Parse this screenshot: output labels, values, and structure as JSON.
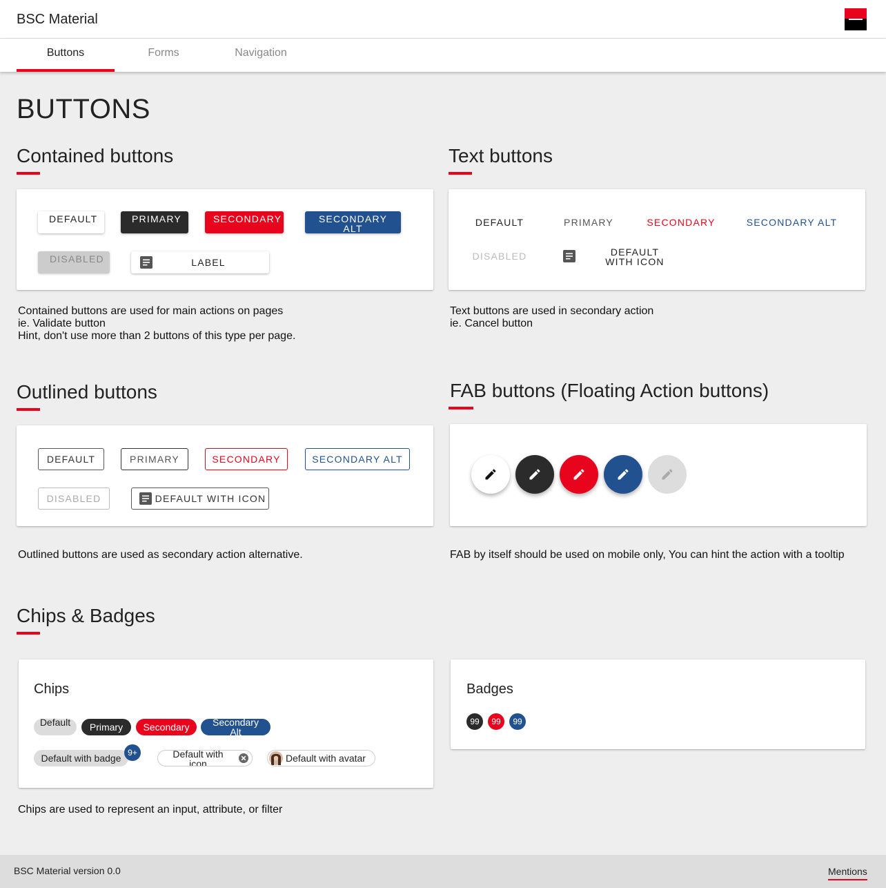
{
  "app": {
    "title": "BSC Material"
  },
  "tabs": [
    {
      "label": "Buttons",
      "active": true
    },
    {
      "label": "Forms",
      "active": false
    },
    {
      "label": "Navigation",
      "active": false
    }
  ],
  "page": {
    "heading": "BUTTONS"
  },
  "colors": {
    "accent": "#e9041e",
    "primary": "#2b2b2b",
    "secondary_alt": "#225190"
  },
  "icons": {
    "document": "document-icon",
    "pencil": "pencil-icon",
    "close": "close-circle-icon"
  },
  "contained": {
    "title": "Contained buttons",
    "buttons": {
      "default": "DEFAULT",
      "primary": "PRIMARY",
      "secondary": "SECONDARY",
      "secondary_alt": "SECONDARY ALT",
      "disabled": "DISABLED",
      "with_icon": "LABEL"
    },
    "description": [
      "Contained buttons are used for main actions on pages",
      "ie. Validate button",
      "Hint, don't use more than 2 buttons of this type per page."
    ]
  },
  "text_buttons": {
    "title": "Text buttons",
    "buttons": {
      "default": "DEFAULT",
      "primary": "PRIMARY",
      "secondary": "SECONDARY",
      "secondary_alt": "SECONDARY ALT",
      "disabled": "DISABLED",
      "with_icon": "DEFAULT WITH ICON"
    },
    "description": [
      "Text buttons are used in secondary action",
      "ie. Cancel button"
    ]
  },
  "outlined": {
    "title": "Outlined buttons",
    "buttons": {
      "default": "DEFAULT",
      "primary": "PRIMARY",
      "secondary": "SECONDARY",
      "secondary_alt": "SECONDARY ALT",
      "disabled": "DISABLED",
      "with_icon": "DEFAULT WITH ICON"
    },
    "description": "Outlined buttons are used as secondary action alternative."
  },
  "fab": {
    "title": "FAB buttons (Floating Action buttons)",
    "description": "FAB by itself should be used on mobile only, You can hint the action with a tooltip"
  },
  "chips_badges": {
    "title": "Chips & Badges",
    "chips": {
      "title": "Chips",
      "default": "Default",
      "primary": "Primary",
      "secondary": "Secondary",
      "secondary_alt": "Secondary Alt",
      "with_badge": "Default with badge",
      "badge": "9+",
      "with_icon": "Default with icon",
      "with_avatar": "Default with avatar"
    },
    "badges": {
      "title": "Badges",
      "values": [
        "99",
        "99",
        "99"
      ]
    },
    "description": "Chips are used to represent an input, attribute, or filter"
  },
  "footer": {
    "version": "BSC Material version 0.0",
    "mentions": "Mentions"
  }
}
